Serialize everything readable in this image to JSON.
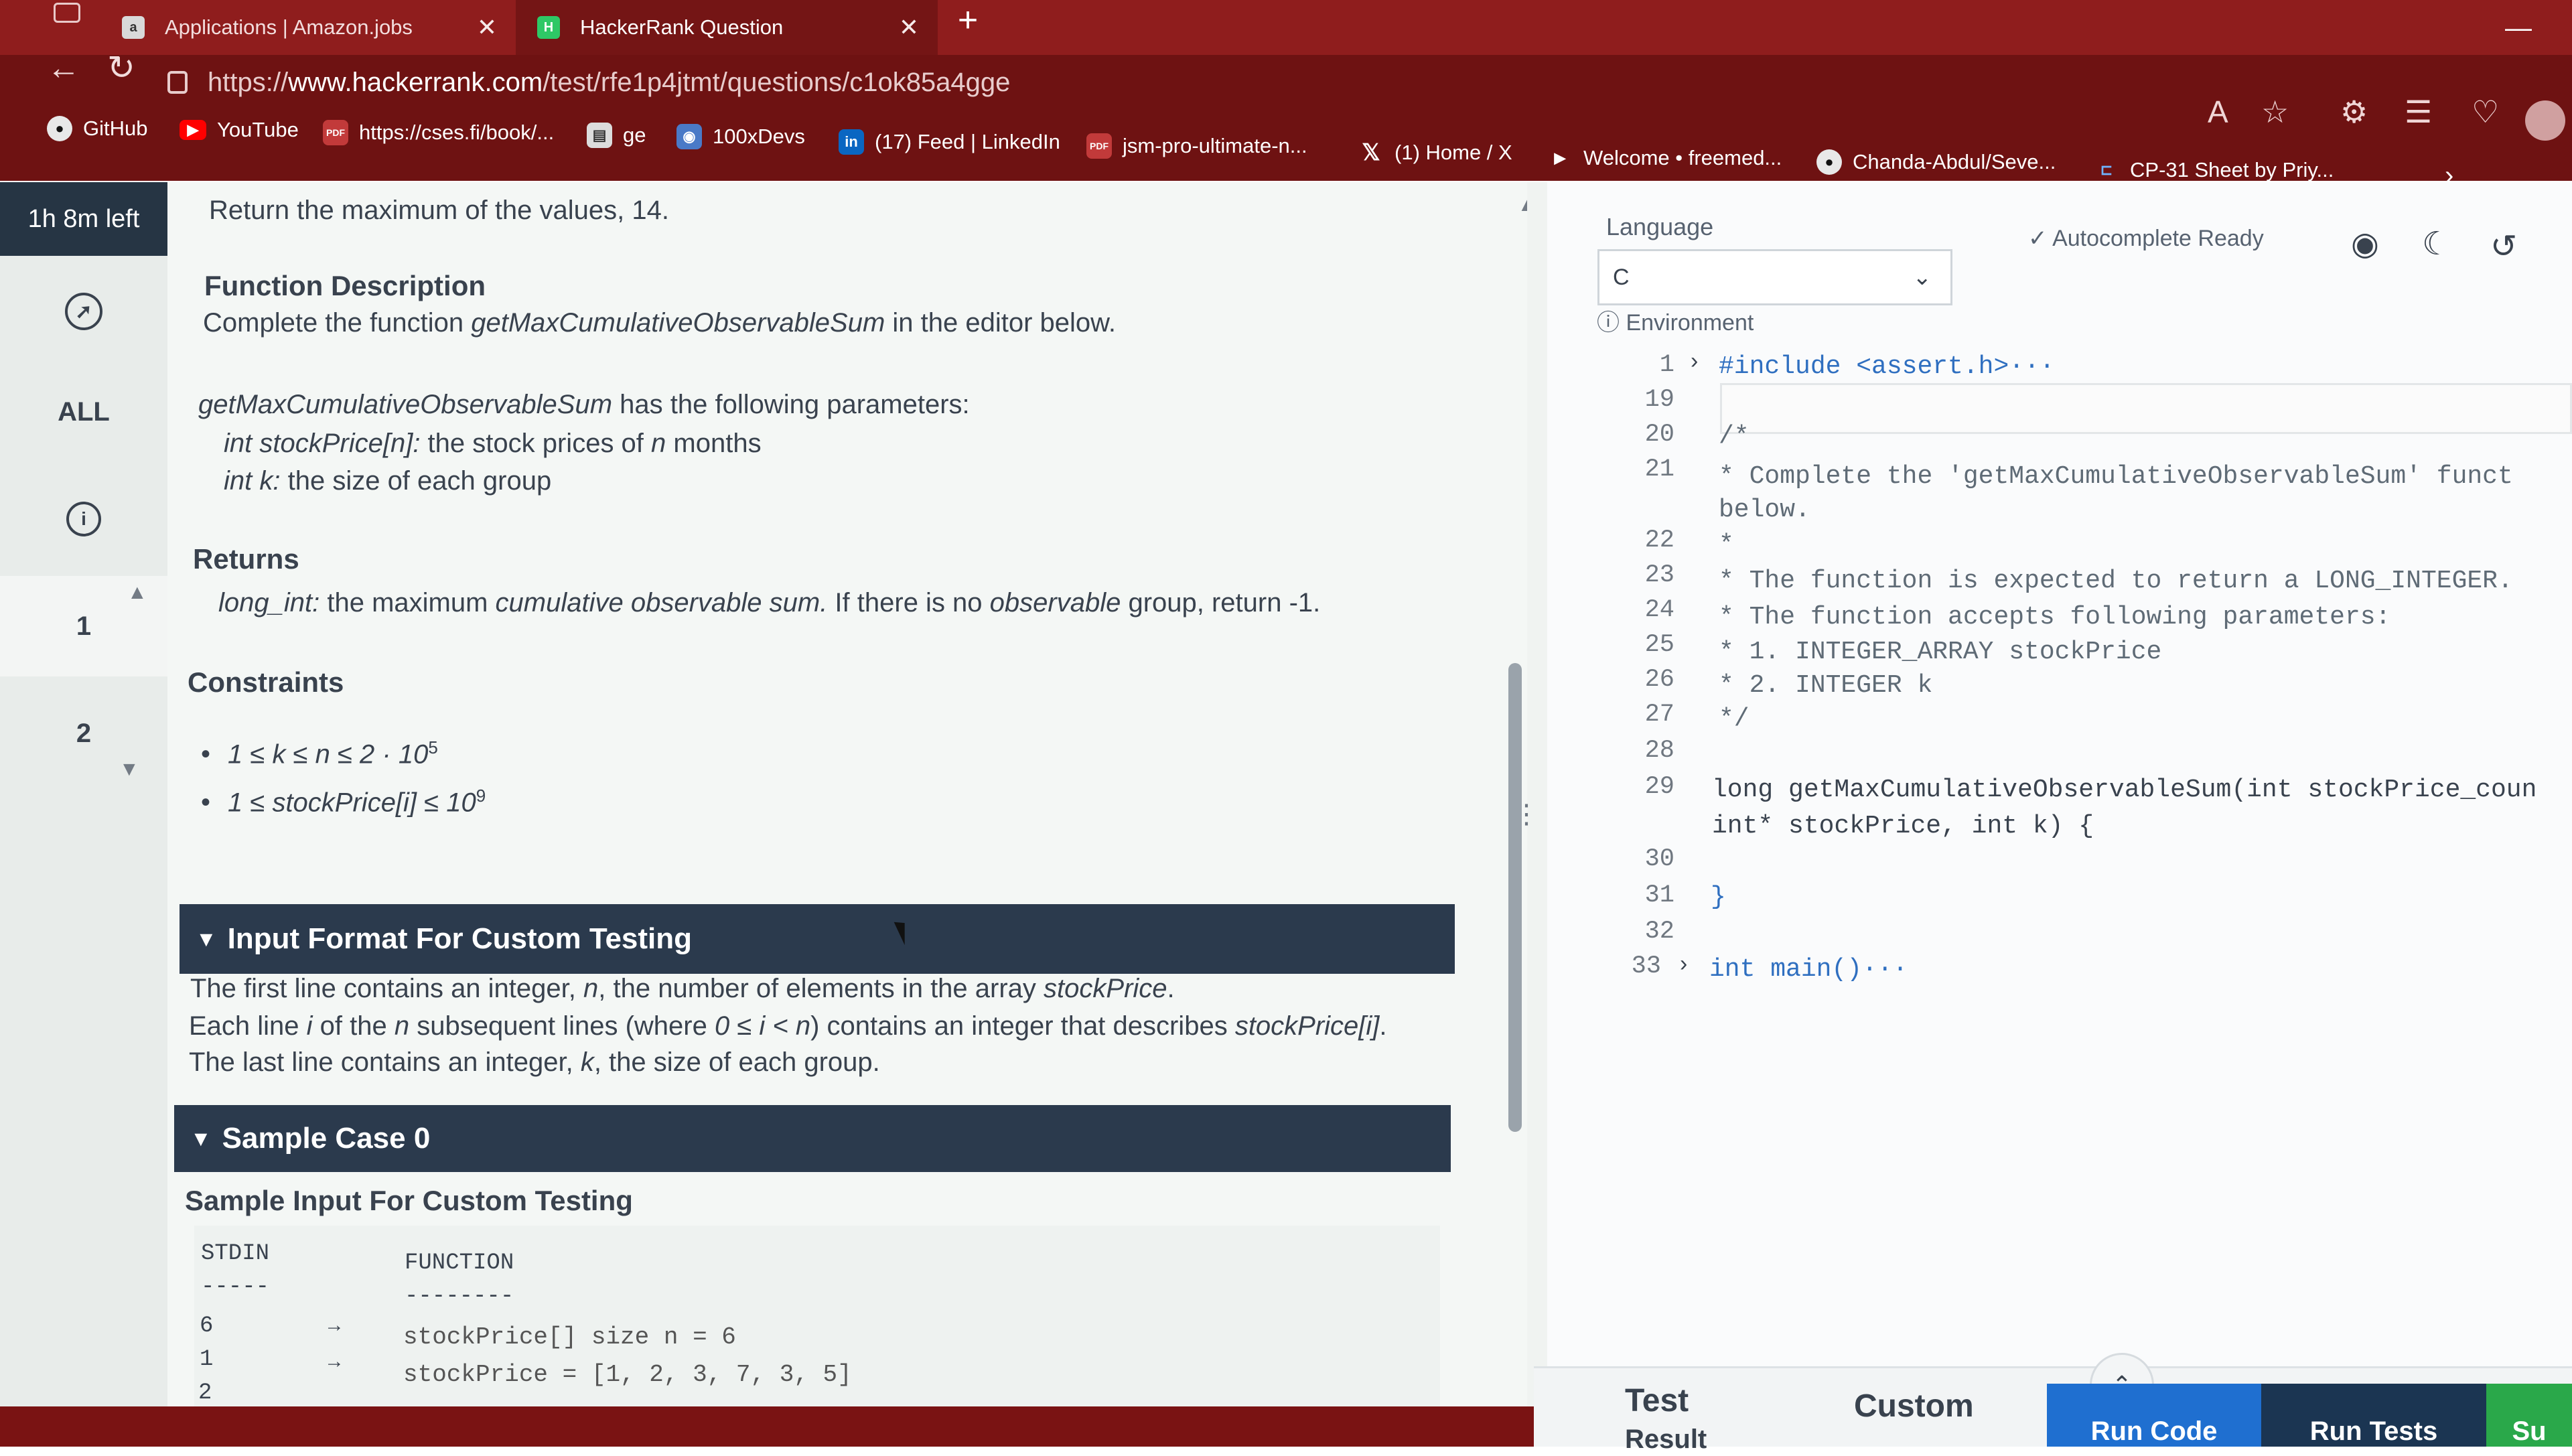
{
  "browser": {
    "tabs": [
      {
        "label": "Applications | Amazon.jobs",
        "active": false
      },
      {
        "label": "HackerRank Question",
        "active": true
      }
    ],
    "url_prefix": "https://",
    "url_domain": "www.hackerrank.com",
    "url_path": "/test/rfe1p4jtmt/questions/c1ok85a4gge",
    "bookmarks": [
      {
        "label": "GitHub",
        "icon": "github-icon"
      },
      {
        "label": "YouTube",
        "icon": "youtube-icon"
      },
      {
        "label": "https://cses.fi/book/...",
        "icon": "pdf-icon"
      },
      {
        "label": "ge",
        "icon": "notebook-icon"
      },
      {
        "label": "100xDevs",
        "icon": "app-icon"
      },
      {
        "label": "(17) Feed | LinkedIn",
        "icon": "linkedin-icon"
      },
      {
        "label": "jsm-pro-ultimate-n...",
        "icon": "pdf-icon"
      },
      {
        "label": "(1) Home / X",
        "icon": "x-icon"
      },
      {
        "label": "Welcome • freemed...",
        "icon": "play-icon"
      },
      {
        "label": "Chanda-Abdul/Seve...",
        "icon": "github-icon"
      },
      {
        "label": "CP-31 Sheet by Priy...",
        "icon": "sheet-icon"
      }
    ]
  },
  "rail": {
    "timer": "1h 8m left",
    "all_label": "ALL",
    "questions": [
      "1",
      "2"
    ]
  },
  "problem": {
    "intro": "Return the maximum of the values, 14.",
    "func_desc_heading": "Function Description",
    "func_desc_pre": "Complete the function ",
    "func_name": "getMaxCumulativeObservableSum",
    "func_desc_post": " in the editor below.",
    "params_post": " has the following parameters:",
    "param1_type": "int stockPrice[n]:",
    "param1_desc_pre": " the stock prices of ",
    "param1_var": "n",
    "param1_desc_post": " months",
    "param2_type": "int k:",
    "param2_desc": " the size of each group",
    "returns_heading": "Returns",
    "returns_type": "long_int:",
    "returns_pre": " the maximum ",
    "returns_em1": "cumulative observable sum.",
    "returns_mid": " If there is no ",
    "returns_em2": "observable",
    "returns_post": " group, return -1.",
    "constraints_heading": "Constraints",
    "constraint1_base": "1 ≤ k ≤ n ≤ 2 · 10",
    "constraint1_exp": "5",
    "constraint2_base": "1 ≤ stockPrice[i] ≤ 10",
    "constraint2_exp": "9",
    "input_format_heading": "Input Format For Custom Testing",
    "input_line1_pre": "The first line contains an integer, ",
    "input_line1_var": "n",
    "input_line1_mid": ", the number of elements in the array ",
    "input_line1_arr": "stockPrice",
    "input_line1_post": ".",
    "input_line2_pre": "Each line ",
    "input_line2_i": "i",
    "input_line2_mid1": " of the ",
    "input_line2_n": "n",
    "input_line2_mid2": " subsequent lines (where ",
    "input_line2_cond": "0 ≤ i < n",
    "input_line2_mid3": ") contains an integer that describes ",
    "input_line2_arr": "stockPrice[i]",
    "input_line2_post": ".",
    "input_line3_pre": "The last line contains an integer, ",
    "input_line3_var": "k",
    "input_line3_post": ", the size of each group.",
    "sample_case_heading": "Sample Case 0",
    "sample_input_heading": "Sample Input For Custom Testing",
    "sample_cols": [
      "STDIN",
      "FUNCTION"
    ],
    "sample_col_underlines": [
      "-----",
      "--------"
    ],
    "sample_rows": [
      {
        "stdin": "6",
        "arrow": "→",
        "func": "stockPrice[] size n = 6"
      },
      {
        "stdin": "1",
        "arrow": "→",
        "func": "stockPrice = [1, 2, 3, 7, 3, 5]"
      },
      {
        "stdin": "2",
        "arrow": "",
        "func": ""
      }
    ]
  },
  "editor": {
    "language_label": "Language",
    "language_value": "C",
    "autocomplete": "Autocomplete Ready",
    "environment": "Environment",
    "lines": [
      {
        "n": "1",
        "text": "#include <assert.h>···"
      },
      {
        "n": "19",
        "text": ""
      },
      {
        "n": "20",
        "text": "/*"
      },
      {
        "n": "21",
        "text": " * Complete the 'getMaxCumulativeObservableSum' funct"
      },
      {
        "n": "",
        "text": " below."
      },
      {
        "n": "22",
        "text": " *"
      },
      {
        "n": "23",
        "text": " * The function is expected to return a LONG_INTEGER."
      },
      {
        "n": "24",
        "text": " * The function accepts following parameters:"
      },
      {
        "n": "25",
        "text": " *  1. INTEGER_ARRAY stockPrice"
      },
      {
        "n": "26",
        "text": " *  2. INTEGER k"
      },
      {
        "n": "27",
        "text": " */"
      },
      {
        "n": "28",
        "text": ""
      },
      {
        "n": "29",
        "text": "long getMaxCumulativeObservableSum(int stockPrice_coun"
      },
      {
        "n": "",
        "text": "int* stockPrice, int k) {"
      },
      {
        "n": "30",
        "text": ""
      },
      {
        "n": "31",
        "text": "}"
      },
      {
        "n": "32",
        "text": ""
      },
      {
        "n": "33",
        "text": "int main()···"
      }
    ]
  },
  "bottom": {
    "tab_test": "Test",
    "tab_test_sub": "Result",
    "tab_custom": "Custom",
    "run_code": "Run Code",
    "run_tests": "Run Tests",
    "submit": "Su"
  }
}
